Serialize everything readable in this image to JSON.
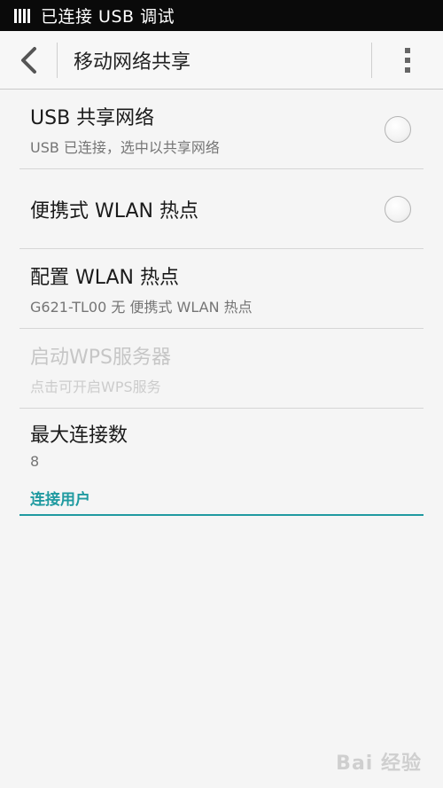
{
  "status_bar": {
    "text": "已连接 USB 调试",
    "icon": "usb-debug-icon"
  },
  "header": {
    "title": "移动网络共享",
    "back_icon": "back-arrow-icon",
    "menu_icon": "more-vert-icon"
  },
  "items": [
    {
      "title": "USB 共享网络",
      "subtitle": "USB 已连接，选中以共享网络",
      "checked": false
    },
    {
      "title": "便携式 WLAN 热点",
      "checked": false
    },
    {
      "title": "配置 WLAN 热点",
      "subtitle": "G621-TL00 无 便携式 WLAN 热点"
    },
    {
      "title": "启动WPS服务器",
      "subtitle": "点击可开启WPS服务",
      "enabled": false
    },
    {
      "title": "最大连接数",
      "subtitle": "8"
    }
  ],
  "section": {
    "title": "连接用户",
    "color": "#1f9aa0"
  },
  "watermark": "Bai 经验"
}
